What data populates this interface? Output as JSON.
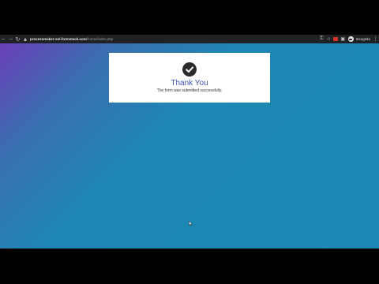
{
  "browser": {
    "url_host": "processmaker-sol.formstack.com",
    "url_path": "/forms/index.php",
    "profile_label": "Incognito"
  },
  "card": {
    "title": "Thank You",
    "message": "The form was submitted successfully."
  },
  "colors": {
    "gradient_start": "#6a3fb8",
    "gradient_end": "#1a8ab5",
    "title_blue": "#3f51b5"
  }
}
